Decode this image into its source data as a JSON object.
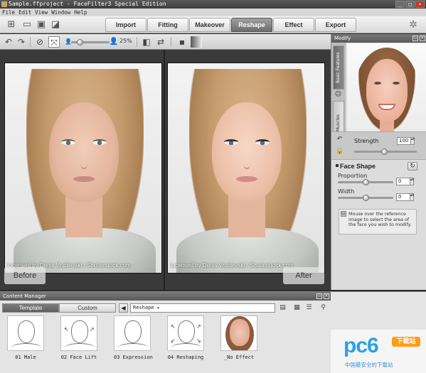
{
  "window": {
    "title": "Sample.ffproject - FaceFilter3 Special Edition",
    "buttons": [
      "_",
      "□",
      "×"
    ]
  },
  "menu": [
    "File",
    "Edit",
    "View",
    "Window",
    "Help"
  ],
  "mode_tabs": [
    {
      "label": "Import",
      "active": false
    },
    {
      "label": "Fitting",
      "active": false
    },
    {
      "label": "Makeover",
      "active": false
    },
    {
      "label": "Reshape",
      "active": true
    },
    {
      "label": "Effect",
      "active": false
    },
    {
      "label": "Export",
      "active": false
    }
  ],
  "editbar": {
    "zoom": "25%"
  },
  "canvas": {
    "credit": "Licensed by Denis Vrublevski / Shutterstock.com",
    "before_label": "Before",
    "after_label": "After"
  },
  "modify_panel": {
    "title": "Modify",
    "vtabs": [
      "Basic Features",
      "Muscles"
    ],
    "strength_label": "Strength",
    "strength_value": "100",
    "face_shape_title": "Face Shape",
    "proportion_label": "Proportion",
    "proportion_value": "0",
    "width_label": "Width",
    "width_value": "0",
    "hint": "Mouse over the reference image to select the area of the face you wish to modify."
  },
  "content_manager": {
    "title": "Content Manager",
    "tabs": [
      {
        "label": "Template",
        "active": true
      },
      {
        "label": "Custom",
        "active": false
      }
    ],
    "path": "Reshape ▸",
    "items": [
      {
        "label": "01 Male",
        "icon": "male-face-sketch"
      },
      {
        "label": "02 Face Lift",
        "icon": "face-lift-sketch"
      },
      {
        "label": "03 Expression",
        "icon": "expression-sketch"
      },
      {
        "label": "04 Reshaping",
        "icon": "reshaping-sketch"
      },
      {
        "label": "_No Effect",
        "icon": "photo-face"
      }
    ]
  },
  "watermark": {
    "logo": "pc6",
    "badge": "下载站",
    "sub": "中国最安全的下载站"
  },
  "colors": {
    "accent": "#6d6d6d",
    "panel": "#dcdcdc",
    "watermark_blue": "#29a1e8",
    "watermark_orange": "#ff9c1a"
  }
}
